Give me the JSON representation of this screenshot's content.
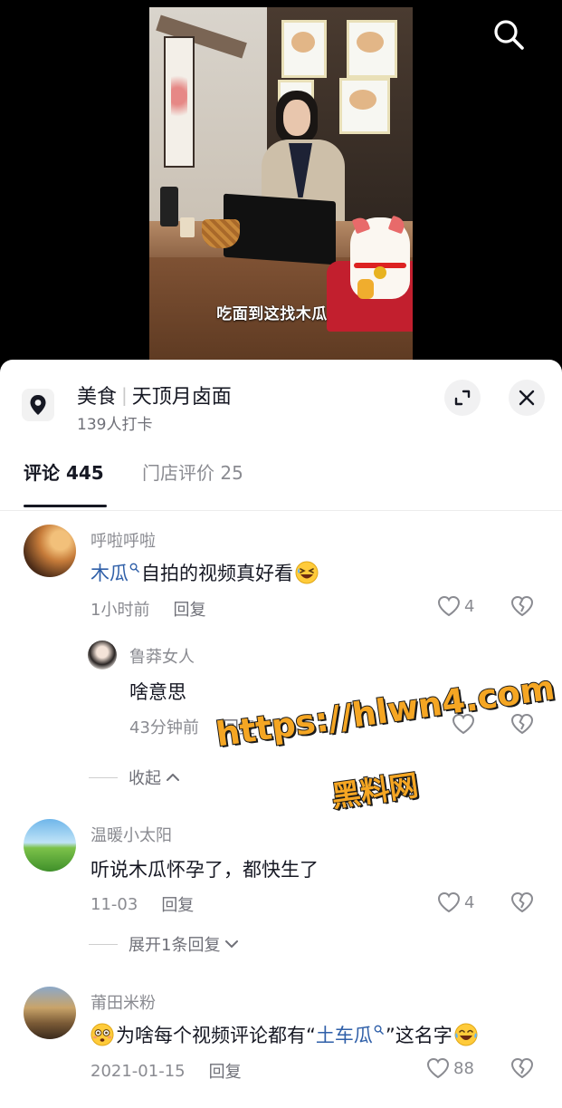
{
  "video": {
    "subtitle": "吃面到这找木瓜"
  },
  "location": {
    "category": "美食",
    "name": "天顶月卤面",
    "checkins": "139人打卡"
  },
  "tabs": [
    {
      "label": "评论 445"
    },
    {
      "label": "门店评价 25"
    }
  ],
  "comments": [
    {
      "user": "呼啦呼啦",
      "link": "木瓜",
      "text": "自拍的视频真好看",
      "emoji": "grinning-squint-sweat",
      "time": "1小时前",
      "reply_label": "回复",
      "likes": "4",
      "replies": [
        {
          "user": "鲁莽女人",
          "text": "啥意思",
          "time": "43分钟前",
          "reply_label": "回复"
        }
      ],
      "toggle_label": "收起"
    },
    {
      "user": "温暖小太阳",
      "text": "听说木瓜怀孕了，都快生了",
      "time": "11-03",
      "reply_label": "回复",
      "likes": "4",
      "toggle_label": "展开1条回复"
    },
    {
      "user": "莆田米粉",
      "prefix_emoji": "flushed",
      "text_before": "为啥每个视频评论都有“",
      "link": "土车瓜",
      "text_after": "”这名字",
      "emoji": "tears-of-joy",
      "time": "2021-01-15",
      "reply_label": "回复",
      "likes": "88"
    }
  ],
  "watermark": {
    "url": "https://hlwn4.com",
    "label": "黑料网"
  },
  "colors": {
    "link": "#2f5fa8",
    "secondary_text": "#8a8b91",
    "watermark": "#f5a623"
  }
}
